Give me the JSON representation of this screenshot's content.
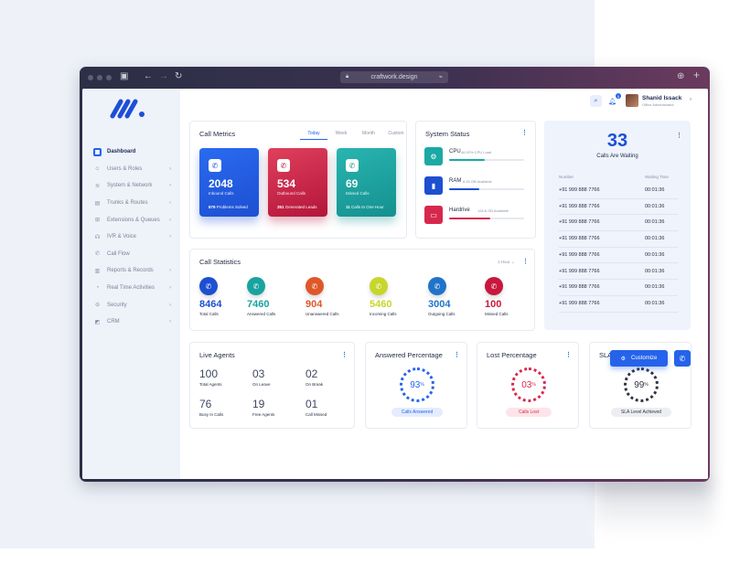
{
  "browser": {
    "url": "craftwork.design"
  },
  "user": {
    "name": "Shanid Issack",
    "role": "Office Administrator",
    "notifications": "5"
  },
  "nav": [
    {
      "label": "Dashboard",
      "icon": "dashboard-icon"
    },
    {
      "label": "Users & Roles",
      "icon": "users-icon"
    },
    {
      "label": "System & Network",
      "icon": "wifi-icon"
    },
    {
      "label": "Trunks & Routes",
      "icon": "trunk-icon"
    },
    {
      "label": "Extensions & Queues",
      "icon": "extension-icon"
    },
    {
      "label": "IVR & Voice",
      "icon": "ivr-icon"
    },
    {
      "label": "Call Flow",
      "icon": "phone-icon"
    },
    {
      "label": "Reports & Records",
      "icon": "reports-icon"
    },
    {
      "label": "Real Time Activities",
      "icon": "activity-icon"
    },
    {
      "label": "Security",
      "icon": "lock-icon"
    },
    {
      "label": "CRM",
      "icon": "crm-icon"
    }
  ],
  "call_metrics": {
    "title": "Call Metrics",
    "tabs": [
      "Today",
      "Week",
      "Month",
      "Custom"
    ],
    "tiles": [
      {
        "value": "2048",
        "label": "Inbound Calls",
        "foot_num": "879",
        "foot_text": "Problems Solved",
        "color1": "#2a6bf0",
        "color2": "#1d4fd1"
      },
      {
        "value": "534",
        "label": "Outbound Calls",
        "foot_num": "351",
        "foot_text": "Generated Leads",
        "color1": "#e0405d",
        "color2": "#b3153a"
      },
      {
        "value": "69",
        "label": "Missed Calls",
        "foot_num": "11",
        "foot_text": "Calls In One Hour",
        "color1": "#29b5b0",
        "color2": "#14908f"
      }
    ]
  },
  "system_status": {
    "title": "System Status",
    "items": [
      {
        "name": "CPU",
        "sub": "46.92% CPU Load",
        "level": 0.47,
        "color": "#1aa9a4"
      },
      {
        "name": "RAM",
        "sub": "8.24 GB Available",
        "level": 0.4,
        "color": "#1d4fd1"
      },
      {
        "name": "Hardrive",
        "sub": "128.8 GB Available",
        "level": 0.55,
        "color": "#d6284d"
      }
    ]
  },
  "waiting": {
    "count": "33",
    "label": "Calls Are Waiting",
    "col_number": "Number",
    "col_time": "Waiting Time",
    "rows": [
      {
        "number": "+91 999 888 7766",
        "time": "00:01:36"
      },
      {
        "number": "+91 999 888 7766",
        "time": "00:01:36"
      },
      {
        "number": "+91 999 888 7766",
        "time": "00:01:36"
      },
      {
        "number": "+91 999 888 7766",
        "time": "00:01:36"
      },
      {
        "number": "+91 999 888 7766",
        "time": "00:01:36"
      },
      {
        "number": "+91 999 888 7766",
        "time": "00:01:36"
      },
      {
        "number": "+91 999 888 7766",
        "time": "00:01:36"
      },
      {
        "number": "+91 999 888 7766",
        "time": "00:01:36"
      }
    ]
  },
  "call_statistics": {
    "title": "Call Statistics",
    "range": "1 Hour",
    "items": [
      {
        "value": "8464",
        "label": "Total Calls",
        "color": "#1d4fd1"
      },
      {
        "value": "7460",
        "label": "Answered Calls",
        "color": "#18a3a0"
      },
      {
        "value": "904",
        "label": "Unanswered Calls",
        "color": "#e0572a"
      },
      {
        "value": "5460",
        "label": "Incoming Calls",
        "color": "#c7d62a"
      },
      {
        "value": "3004",
        "label": "Outgoing Calls",
        "color": "#1f74c9"
      },
      {
        "value": "100",
        "label": "Missed Calls",
        "color": "#c8173d"
      }
    ]
  },
  "live_agents": {
    "title": "Live Agents",
    "items": [
      {
        "value": "100",
        "label": "Total Agents"
      },
      {
        "value": "03",
        "label": "On Leave"
      },
      {
        "value": "02",
        "label": "On Break"
      },
      {
        "value": "76",
        "label": "Busy In Calls"
      },
      {
        "value": "19",
        "label": "Free Agents"
      },
      {
        "value": "01",
        "label": "Call Missed"
      }
    ]
  },
  "answered": {
    "title": "Answered Percentage",
    "value": "93",
    "unit": "%",
    "pill": "Calls Answered"
  },
  "lost": {
    "title": "Lost Percentage",
    "value": "03",
    "unit": "%",
    "pill": "Calls Lost"
  },
  "sla": {
    "title": "SLA",
    "value": "99",
    "unit": "%",
    "pill": "SLA Level Achieved"
  },
  "customize_label": "Customize"
}
